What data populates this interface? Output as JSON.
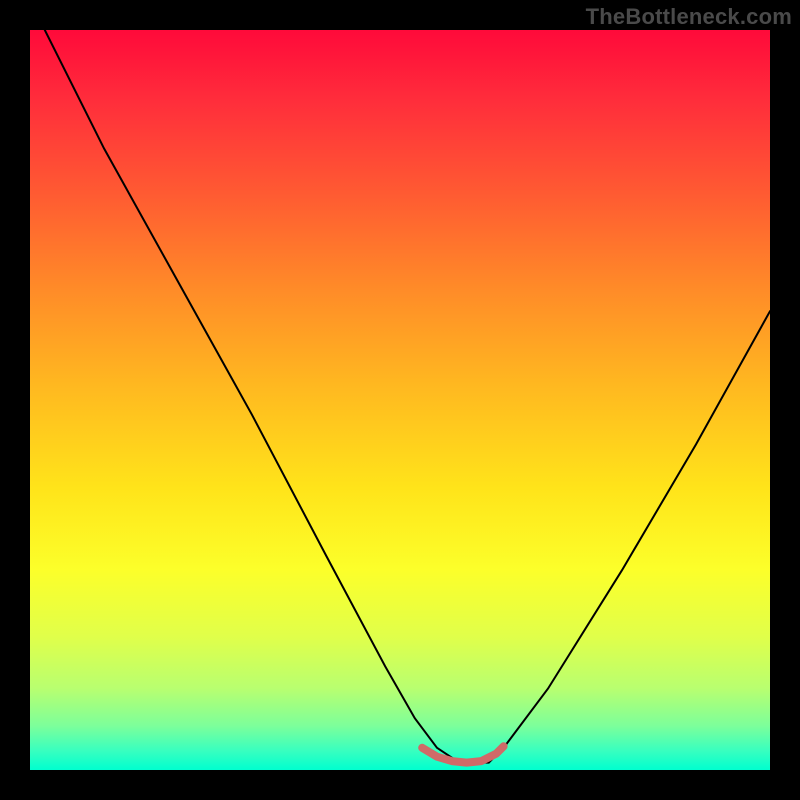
{
  "watermark": "TheBottleneck.com",
  "chart_data": {
    "type": "line",
    "title": "",
    "xlabel": "",
    "ylabel": "",
    "xlim": [
      0,
      100
    ],
    "ylim": [
      0,
      100
    ],
    "background_gradient": {
      "top": "#ff0a3a",
      "bottom": "#00ffcf"
    },
    "series": [
      {
        "name": "bottleneck-main-curve",
        "color": "#000000",
        "stroke_width": 2,
        "x": [
          2,
          10,
          20,
          30,
          40,
          48,
          52,
          55,
          58,
          62,
          64,
          70,
          80,
          90,
          100
        ],
        "values": [
          100,
          84,
          66,
          48,
          29,
          14,
          7,
          3,
          1,
          1,
          3,
          11,
          27,
          44,
          62
        ]
      },
      {
        "name": "bottleneck-floor-marker",
        "color": "#d06a68",
        "stroke_width": 8,
        "x": [
          53,
          55,
          57,
          59,
          61,
          63,
          64
        ],
        "values": [
          3.0,
          1.8,
          1.2,
          1.0,
          1.2,
          2.2,
          3.2
        ]
      }
    ]
  }
}
